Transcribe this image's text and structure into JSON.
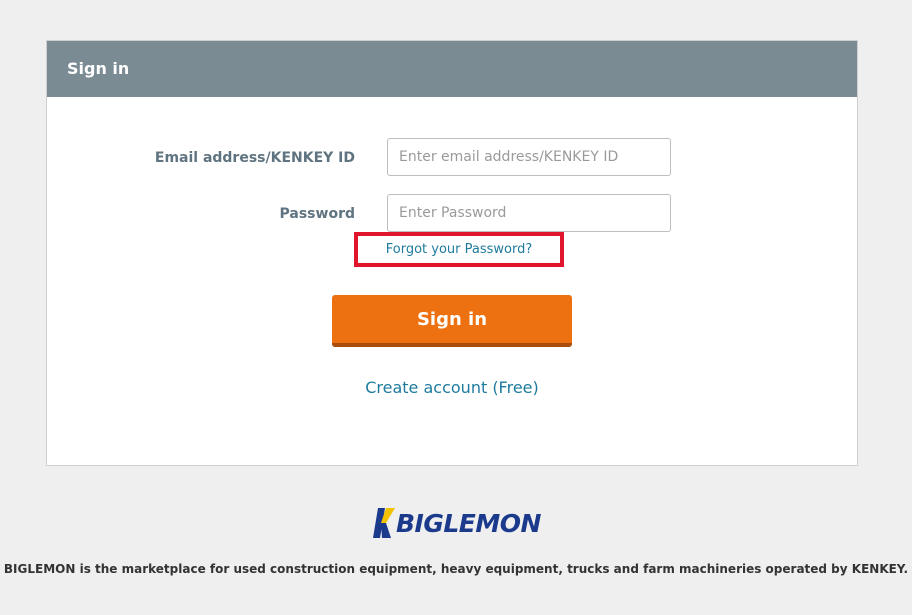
{
  "panel": {
    "title": "Sign in"
  },
  "form": {
    "email_label": "Email address/KENKEY ID",
    "email_placeholder": "Enter email address/KENKEY ID",
    "email_value": "",
    "password_label": "Password",
    "password_placeholder": "Enter Password",
    "password_value": "",
    "forgot_link": "Forgot your Password?",
    "signin_button": "Sign in",
    "create_account_link": "Create account (Free)"
  },
  "brand": {
    "logo_icon": "biglemon-k-mark-icon",
    "logo_text": "BIGLEMON",
    "colors": {
      "logo_blue": "#1b3a8c",
      "logo_yellow": "#f2c200",
      "button_orange": "#ee7111",
      "header_gray": "#7a8b94",
      "link_teal": "#1e7b9e",
      "highlight_red": "#e0142a"
    }
  },
  "footer": {
    "description": "BIGLEMON is the marketplace for used construction equipment, heavy equipment, trucks and farm machineries operated by KENKEY."
  }
}
